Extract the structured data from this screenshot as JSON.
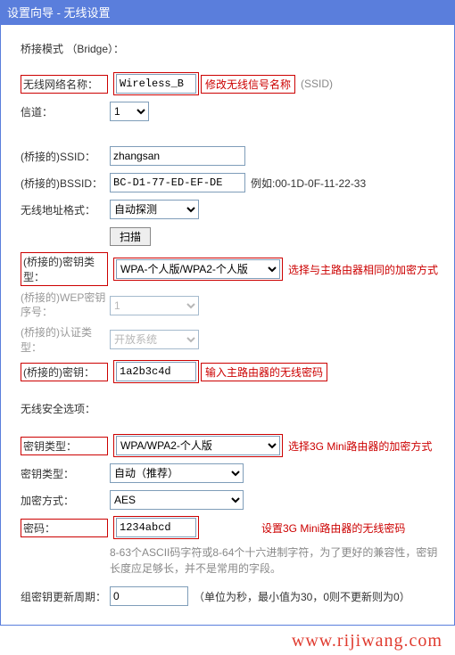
{
  "title": "设置向导 - 无线设置",
  "bridge_mode_label": "桥接模式    （Bridge）：",
  "wireless_name_label": "无线网络名称：",
  "wireless_name_value": "Wireless_B",
  "wireless_name_annot": "修改无线信号名称",
  "ssid_suffix": "(SSID)",
  "channel_label": "信道：",
  "channel_value": "1",
  "bridge_ssid_label": "(桥接的)SSID：",
  "bridge_ssid_value": "zhangsan",
  "bridge_bssid_label": "(桥接的)BSSID：",
  "bridge_bssid_value": "BC-D1-77-ED-EF-DE",
  "bridge_bssid_example": "例如:00-1D-0F-11-22-33",
  "addr_format_label": "无线地址格式：",
  "addr_format_value": "自动探测",
  "scan_button": "扫描",
  "bridge_key_type_label": "(桥接的)密钥类型：",
  "bridge_key_type_value": "WPA-个人版/WPA2-个人版",
  "bridge_key_type_annot": "选择与主路由器相同的加密方式",
  "bridge_wep_label": "(桥接的)WEP密钥序号：",
  "bridge_wep_value": "1",
  "bridge_auth_label": "(桥接的)认证类型：",
  "bridge_auth_value": "开放系统",
  "bridge_pwd_label": "(桥接的)密钥：",
  "bridge_pwd_value": "1a2b3c4d",
  "bridge_pwd_annot": "输入主路由器的无线密码",
  "security_label": "无线安全选项：",
  "key_type_label": "密钥类型：",
  "key_type_value": "WPA/WPA2-个人版",
  "key_type_annot": "选择3G Mini路由器的加密方式",
  "key_type2_label": "密钥类型：",
  "key_type2_value": "自动（推荐）",
  "enc_label": "加密方式：",
  "enc_value": "AES",
  "pwd_label": "密码：",
  "pwd_value": "1234abcd",
  "pwd_annot": "设置3G Mini路由器的无线密码",
  "pwd_help": "8-63个ASCII码字符或8-64个十六进制字符，为了更好的兼容性，密钥长度应足够长，并不是常用的字段。",
  "group_key_label": "组密钥更新周期：",
  "group_key_value": "0",
  "group_key_hint": "（单位为秒，最小值为30，0则不更新则为0）",
  "watermark": "www.rijiwang.com"
}
